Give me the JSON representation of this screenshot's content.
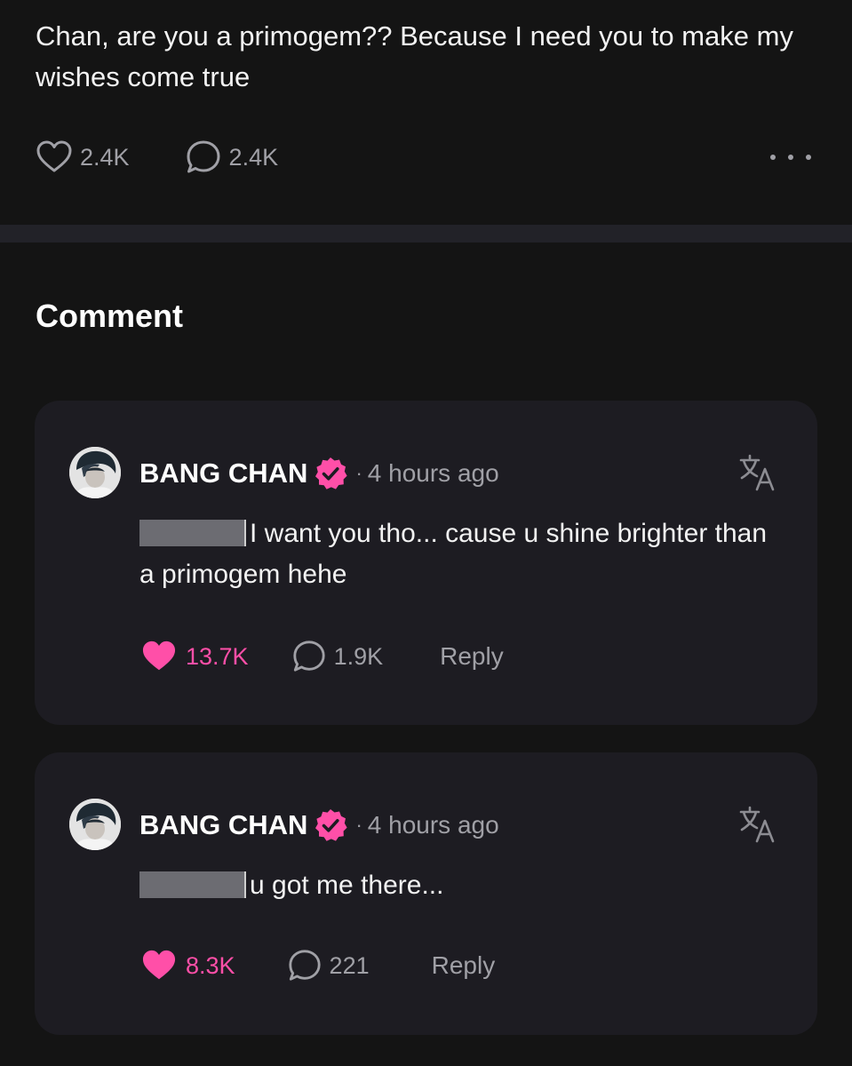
{
  "post": {
    "text": "Chan, are you a primogem?? Because I need you to make my wishes come true",
    "likes": "2.4K",
    "comments": "2.4K"
  },
  "comments_section": {
    "title": "Comment"
  },
  "comments": [
    {
      "author": "BANG CHAN",
      "time": "4 hours ago",
      "text": "I want you tho... cause u shine brighter than a primogem hehe",
      "likes": "13.7K",
      "replies": "1.9K",
      "reply_label": "Reply"
    },
    {
      "author": "BANG CHAN",
      "time": "4 hours ago",
      "text": "u got me there...",
      "likes": "8.3K",
      "replies": "221",
      "reply_label": "Reply"
    }
  ],
  "colors": {
    "accent_pink": "#ff4fa8",
    "background": "#141414",
    "card": "#1d1c22",
    "muted_text": "#a0a0a6"
  },
  "icons": {
    "like": "heart-icon",
    "comment": "comment-bubble-icon",
    "more": "more-dots-icon",
    "verified": "verified-badge-icon",
    "translate": "translate-icon"
  }
}
